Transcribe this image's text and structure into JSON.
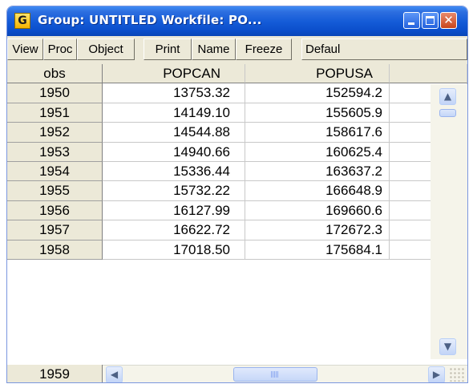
{
  "window": {
    "app_icon_letter": "G",
    "title": "Group: UNTITLED   Workfile: PO...",
    "controls": {
      "minimize": "minimize",
      "maximize": "maximize",
      "close": "✕"
    }
  },
  "toolbar": {
    "view": "View",
    "proc": "Proc",
    "object": "Object",
    "print": "Print",
    "name": "Name",
    "freeze": "Freeze",
    "default": "Defaul"
  },
  "table": {
    "headers": [
      "obs",
      "POPCAN",
      "POPUSA",
      ""
    ],
    "rows": [
      {
        "obs": "1950",
        "popcan": "13753.32",
        "popusa": "152594.2"
      },
      {
        "obs": "1951",
        "popcan": "14149.10",
        "popusa": "155605.9"
      },
      {
        "obs": "1952",
        "popcan": "14544.88",
        "popusa": "158617.6"
      },
      {
        "obs": "1953",
        "popcan": "14940.66",
        "popusa": "160625.4"
      },
      {
        "obs": "1954",
        "popcan": "15336.44",
        "popusa": "163637.2"
      },
      {
        "obs": "1955",
        "popcan": "15732.22",
        "popusa": "166648.9"
      },
      {
        "obs": "1956",
        "popcan": "16127.99",
        "popusa": "169660.6"
      },
      {
        "obs": "1957",
        "popcan": "16622.72",
        "popusa": "172672.3"
      },
      {
        "obs": "1958",
        "popcan": "17018.50",
        "popusa": "175684.1"
      },
      {
        "obs": "1959",
        "popcan": "",
        "popusa": ""
      }
    ]
  },
  "scrollbars": {
    "up": "▲",
    "down": "▼",
    "left": "◀",
    "right": "▶"
  },
  "colors": {
    "title_bar": "#155cd8",
    "chrome": "#ece9d8",
    "scroll_button": "#c2d4f7"
  }
}
